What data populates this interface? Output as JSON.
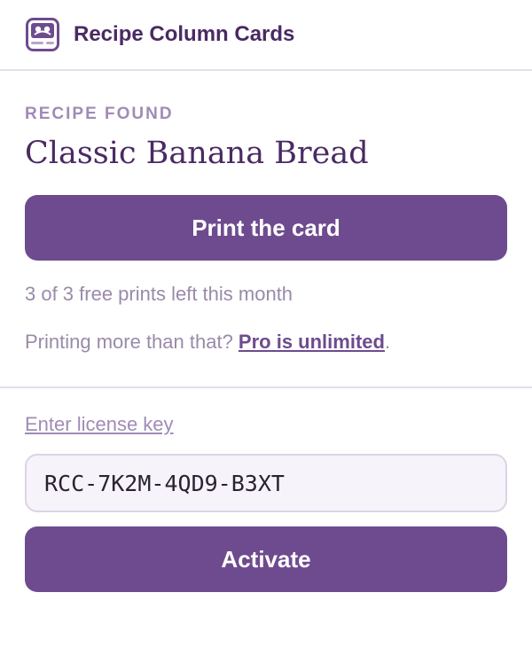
{
  "header": {
    "logo_icon": "recipe-card-logo-icon",
    "title": "Recipe Column Cards"
  },
  "recipe": {
    "eyebrow": "RECIPE FOUND",
    "title": "Classic Banana Bread"
  },
  "print": {
    "button_label": "Print the card",
    "free_prints_text": "3 of 3 free prints left this month",
    "upsell_prefix": "Printing more than that? ",
    "upsell_link": "Pro is unlimited",
    "upsell_suffix": "."
  },
  "license": {
    "label": "Enter license key",
    "value": "RCC-7K2M-4QD9-B3XT",
    "activate_label": "Activate"
  },
  "colors": {
    "accent": "#6e4b8e",
    "title": "#4a2a63",
    "muted": "#9a8aa9",
    "divider": "#e4e0ea"
  }
}
